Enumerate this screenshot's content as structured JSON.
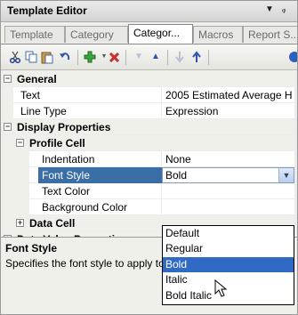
{
  "window": {
    "title": "Template Editor",
    "controls": [
      "▼",
      "ᵩ"
    ]
  },
  "tabs": [
    {
      "label": "Template",
      "active": false
    },
    {
      "label": "Category",
      "active": false
    },
    {
      "label": "Categor...",
      "active": true
    },
    {
      "label": "Macros",
      "active": false
    },
    {
      "label": "Report S...",
      "active": false
    }
  ],
  "toolbar": {
    "icons": [
      "cut-icon",
      "copy-icon",
      "paste-icon",
      "undo-icon",
      "add-icon",
      "delete-icon",
      "move-down-icon",
      "move-up-icon",
      "move-last-icon",
      "move-first-icon",
      "help-icon"
    ]
  },
  "grid": {
    "general": {
      "label": "General",
      "expander": "−"
    },
    "text": {
      "label": "Text",
      "value": "2005 Estimated Average H"
    },
    "line_type": {
      "label": "Line Type",
      "value": "Expression"
    },
    "display": {
      "label": "Display Properties",
      "expander": "−"
    },
    "profile_cell": {
      "label": "Profile Cell",
      "expander": "−"
    },
    "indentation": {
      "label": "Indentation",
      "value": "None"
    },
    "font_style": {
      "label": "Font Style",
      "value": "Bold"
    },
    "text_color": {
      "label": "Text Color"
    },
    "background_color": {
      "label": "Background Color"
    },
    "data_cell": {
      "label": "Data Cell",
      "expander": "+"
    },
    "data_value": {
      "label": "Data Value Properties",
      "expander": "+"
    }
  },
  "dropdown": {
    "options": [
      "Default",
      "Regular",
      "Bold",
      "Italic",
      "Bold Italic"
    ],
    "highlighted_index": 2
  },
  "description": {
    "title": "Font Style",
    "text": "Specifies the font style to apply to text"
  },
  "colors": {
    "selection": "#3a6ea5",
    "highlight": "#316ac5",
    "category_bg": "#f0f0ea"
  }
}
